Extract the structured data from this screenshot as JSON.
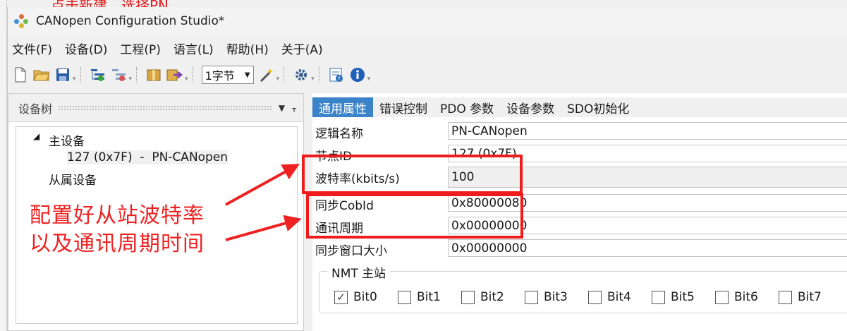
{
  "background": {
    "partial_text": "点击新建，选择PN"
  },
  "window": {
    "title": "CANopen Configuration Studio*"
  },
  "menu": [
    "文件(F)",
    "设备(D)",
    "工程(P)",
    "语言(L)",
    "帮助(H)",
    "关于(A)"
  ],
  "toolbar": {
    "icons": [
      "new-file-icon",
      "open-folder-icon",
      "save-icon",
      "add-node-icon",
      "remove-node-icon",
      "package-icon",
      "export-icon",
      "wand-icon",
      "gear-icon",
      "help-doc-icon",
      "info-icon"
    ],
    "byte_combo": "1字节"
  },
  "left_panel": {
    "title": "设备树",
    "tree": {
      "master": "主设备",
      "master_child": "127 (0x7F)  -  PN-CANopen",
      "slaves": "从属设备"
    }
  },
  "tabs": [
    "通用属性",
    "错误控制",
    "PDO 参数",
    "设备参数",
    "SDO初始化"
  ],
  "properties": [
    {
      "label": "逻辑名称",
      "value": "PN-CANopen"
    },
    {
      "label": "节点ID",
      "value": "127 (0x7F)"
    },
    {
      "label": "波特率(kbits/s)",
      "value": "100"
    },
    {
      "label": "同步CobId",
      "value": "0x80000080"
    },
    {
      "label": "通讯周期",
      "value": "0x00000000"
    },
    {
      "label": "同步窗口大小",
      "value": "0x00000000"
    }
  ],
  "nmt": {
    "title": "NMT 主站",
    "bits": [
      {
        "label": "Bit0",
        "checked": true
      },
      {
        "label": "Bit1",
        "checked": false
      },
      {
        "label": "Bit2",
        "checked": false
      },
      {
        "label": "Bit3",
        "checked": false
      },
      {
        "label": "Bit4",
        "checked": false
      },
      {
        "label": "Bit5",
        "checked": false
      },
      {
        "label": "Bit6",
        "checked": false
      },
      {
        "label": "Bit7",
        "checked": false
      }
    ]
  },
  "annotation": {
    "line1": "配置好从站波特率",
    "line2": "以及通讯周期时间",
    "color": "#ee2222"
  }
}
